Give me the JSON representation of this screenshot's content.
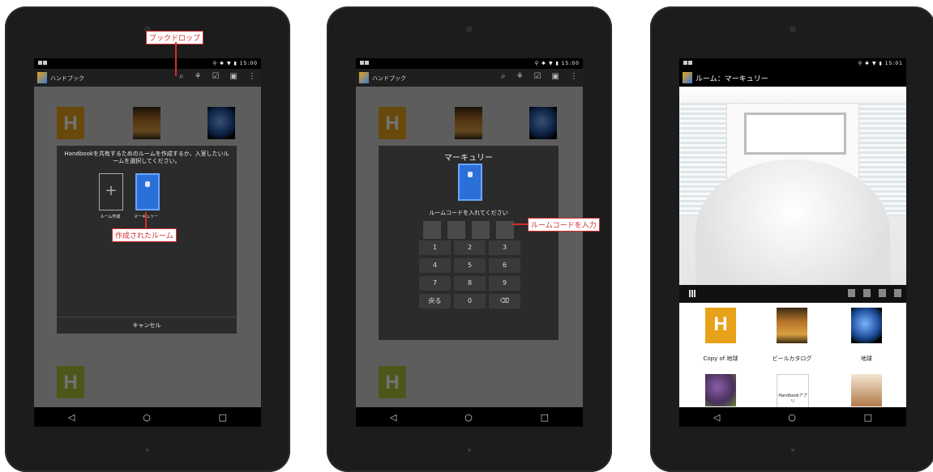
{
  "tablet1": {
    "status_time": "15:00",
    "app_title": "ハンドブック",
    "dialog_message": "Handbookを共有するためのルームを作成するか、入室したいルームを選択してください。",
    "create_room_label": "ルーム作成",
    "room_name": "マーキュリー",
    "cancel_label": "キャンセル",
    "callout_top": "ブックドロップ",
    "callout_room": "作成されたルーム",
    "nav": [
      "◁",
      "○",
      "□"
    ]
  },
  "tablet2": {
    "status_time": "15:00",
    "app_title": "ハンドブック",
    "dialog_title": "マーキュリー",
    "prompt": "ルームコードを入れてください",
    "callout_code": "ルームコードを入力",
    "keys": [
      "1",
      "2",
      "3",
      "4",
      "5",
      "6",
      "7",
      "8",
      "9",
      "戻る",
      "0",
      "⌫"
    ],
    "nav": [
      "◁",
      "○",
      "□"
    ]
  },
  "tablet3": {
    "status_time": "15:01",
    "room_title": "ルーム：マーキュリー",
    "books": [
      {
        "label": "Copy of 地球",
        "thumb_text": "H"
      },
      {
        "label": "ビールカタログ",
        "thumb_text": ""
      },
      {
        "label": "地球",
        "thumb_text": ""
      }
    ],
    "handbook_app_label": "Handbookアプリ",
    "nav": [
      "◁",
      "○",
      "□"
    ]
  },
  "colors": {
    "accent_red": "#d32f2f",
    "door_blue": "#2b6fd8",
    "handbook_orange": "#e8a21a"
  }
}
